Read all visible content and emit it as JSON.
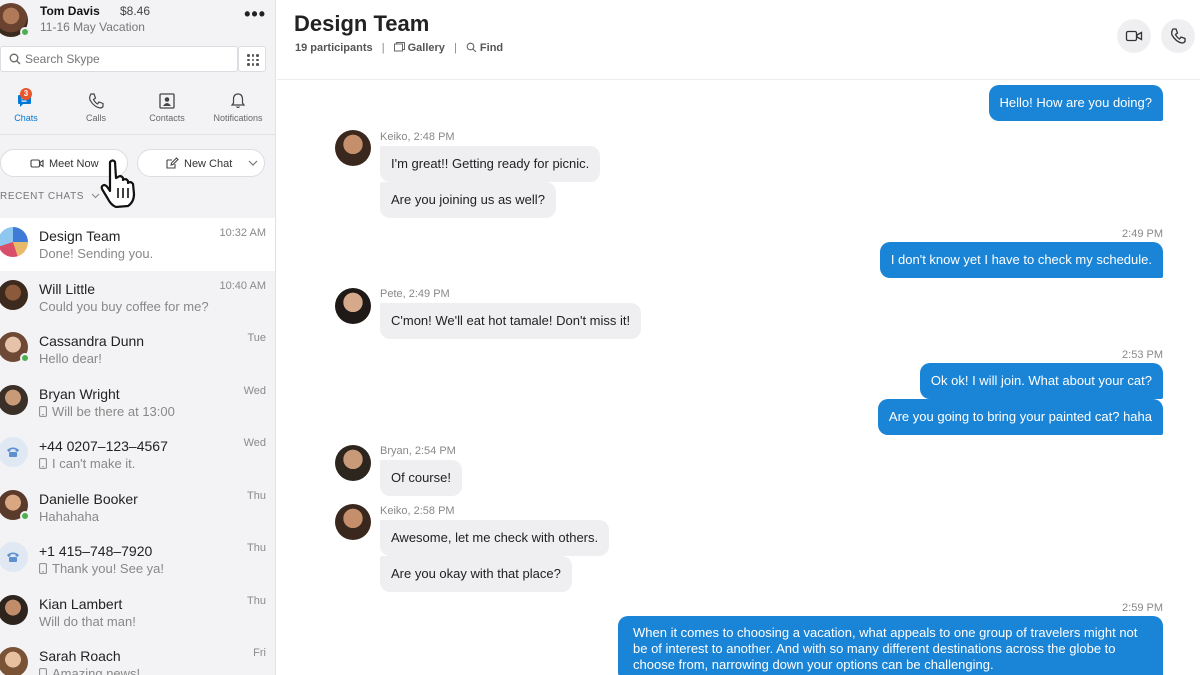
{
  "profile": {
    "name": "Tom Davis",
    "credit": "$8.46",
    "mood": "11-16 May Vacation",
    "more_label": "•••"
  },
  "search": {
    "placeholder": "Search Skype"
  },
  "nav": {
    "tabs": [
      {
        "label": "Chats",
        "icon": "chat-icon",
        "badge": "3",
        "active": true
      },
      {
        "label": "Calls",
        "icon": "phone-icon"
      },
      {
        "label": "Contacts",
        "icon": "contacts-icon"
      },
      {
        "label": "Notifications",
        "icon": "bell-icon"
      }
    ]
  },
  "actions": {
    "meet_now": "Meet Now",
    "new_chat": "New Chat"
  },
  "recent_header": "RECENT CHATS",
  "chats": [
    {
      "name": "Design Team",
      "time": "10:32 AM",
      "preview": "Done! Sending you.",
      "avatar": "group-avatar"
    },
    {
      "name": "Will Little",
      "time": "10:40 AM",
      "preview": "Could you buy coffee for me?",
      "avatar": "person-avatar"
    },
    {
      "name": "Cassandra Dunn",
      "time": "Tue",
      "preview": "Hello dear!",
      "avatar": "person-avatar",
      "online": true
    },
    {
      "name": "Bryan Wright",
      "time": "Wed",
      "preview": "Will be there at 13:00",
      "avatar": "person-avatar",
      "phone": true
    },
    {
      "name": "+44 0207–123–4567",
      "time": "Wed",
      "preview": "I can't make it.",
      "avatar": "phone-contact-avatar",
      "phone": true
    },
    {
      "name": "Danielle Booker",
      "time": "Thu",
      "preview": "Hahahaha",
      "avatar": "person-avatar",
      "online": true
    },
    {
      "name": "+1 415–748–7920",
      "time": "Thu",
      "preview": "Thank you! See ya!",
      "avatar": "phone-contact-avatar",
      "phone": true
    },
    {
      "name": "Kian Lambert",
      "time": "Thu",
      "preview": "Will do that man!",
      "avatar": "person-avatar"
    },
    {
      "name": "Sarah Roach",
      "time": "Fri",
      "preview": "Amazing news!",
      "avatar": "person-avatar",
      "phone": true
    }
  ],
  "conversation": {
    "title": "Design Team",
    "participants": "19 participants",
    "gallery": "Gallery",
    "find": "Find",
    "messages": [
      {
        "dir": "out",
        "text": "Hello! How are you doing?"
      },
      {
        "dir": "in",
        "sender": "Keiko, 2:48 PM",
        "texts": [
          "I'm great!! Getting ready for picnic.",
          "Are you joining us as well?"
        ]
      },
      {
        "dir": "out",
        "time": "2:49 PM",
        "text": "I don't know yet I have to check my schedule."
      },
      {
        "dir": "in",
        "sender": "Pete, 2:49 PM",
        "texts": [
          "C'mon! We'll eat hot tamale! Don't miss it!"
        ]
      },
      {
        "dir": "out",
        "time": "2:53 PM",
        "texts": [
          "Ok ok! I will join. What about your cat?",
          "Are you going to bring your painted cat? haha"
        ]
      },
      {
        "dir": "in",
        "sender": "Bryan, 2:54 PM",
        "texts": [
          "Of course!"
        ]
      },
      {
        "dir": "in",
        "sender": "Keiko, 2:58 PM",
        "texts": [
          "Awesome, let me check with others.",
          "Are you okay with that place?"
        ]
      },
      {
        "dir": "out",
        "time": "2:59 PM",
        "text": "When it comes to choosing a vacation, what appeals to one group of travelers might not be of interest to another. And with so many different destinations across the globe to choose from, narrowing down your options can be challenging."
      }
    ]
  },
  "colors": {
    "accent": "#0078d4",
    "outgoing_bubble": "#1a84d6",
    "incoming_bubble": "#efeff2",
    "badge": "#e8562b",
    "online": "#4caf50"
  }
}
